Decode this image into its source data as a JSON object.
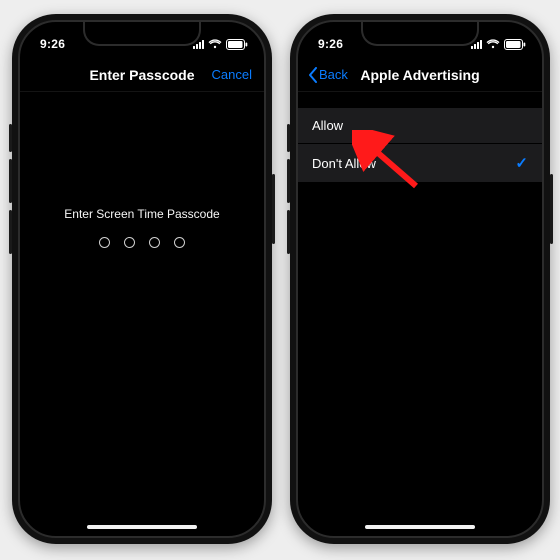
{
  "status": {
    "time": "9:26"
  },
  "left": {
    "nav_title": "Enter Passcode",
    "nav_right": "Cancel",
    "prompt": "Enter Screen Time Passcode"
  },
  "right": {
    "nav_title": "Apple Advertising",
    "nav_back": "Back",
    "options": [
      {
        "label": "Allow"
      },
      {
        "label": "Don't Allow",
        "selected": true
      }
    ],
    "check_glyph": "✓"
  }
}
